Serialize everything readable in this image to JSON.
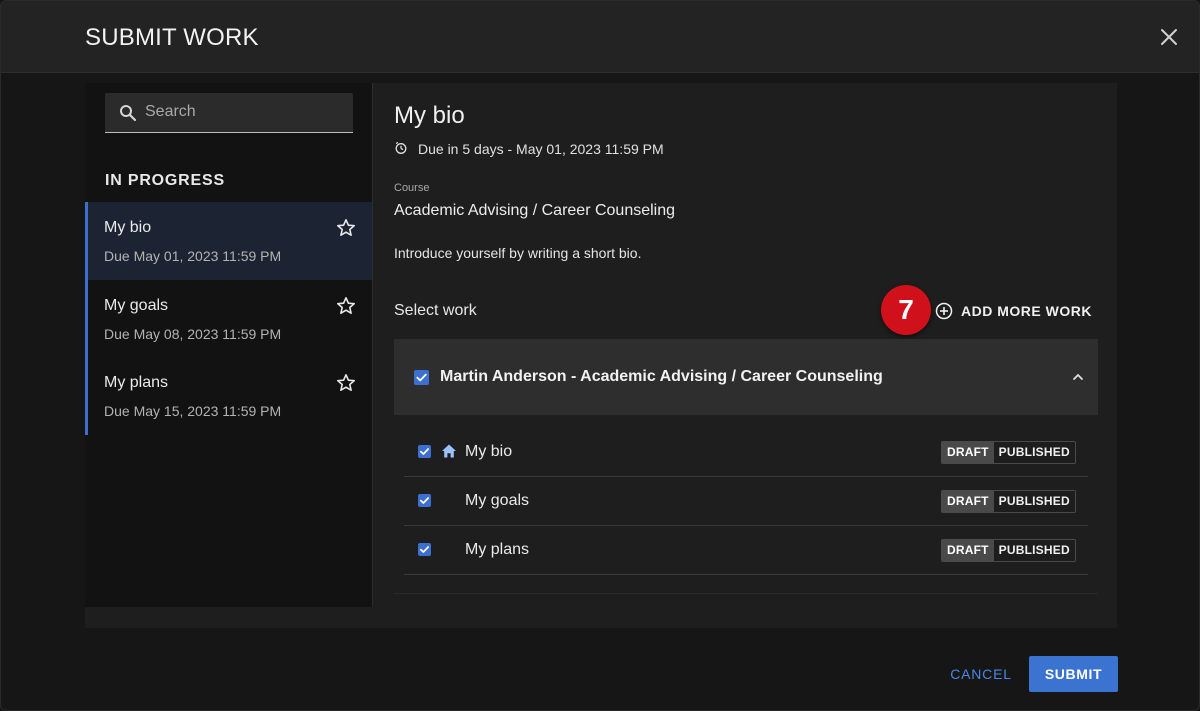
{
  "dialog": {
    "title": "SUBMIT WORK"
  },
  "search": {
    "placeholder": "Search",
    "value": ""
  },
  "sidebar": {
    "section_label": "IN PROGRESS",
    "items": [
      {
        "name": "My bio",
        "due": "Due May 01, 2023 11:59 PM",
        "active": true
      },
      {
        "name": "My goals",
        "due": "Due May 08, 2023 11:59 PM",
        "active": false
      },
      {
        "name": "My plans",
        "due": "Due May 15, 2023 11:59 PM",
        "active": false
      }
    ]
  },
  "main": {
    "title": "My bio",
    "due_text": "Due in 5 days - May 01, 2023 11:59 PM",
    "course_label": "Course",
    "course_name": "Academic Advising / Career Counseling",
    "description": "Introduce yourself by writing a short bio.",
    "select_label": "Select work",
    "step_badge": "7",
    "add_more_label": "ADD MORE WORK",
    "group": {
      "name": "Martin Anderson - Academic Advising / Career Counseling",
      "checked": true,
      "expanded": true
    },
    "work_items": [
      {
        "name": "My bio",
        "checked": true,
        "icon": "home-icon",
        "draft_label": "DRAFT",
        "published_label": "PUBLISHED",
        "status": "DRAFT"
      },
      {
        "name": "My goals",
        "checked": true,
        "icon": "",
        "draft_label": "DRAFT",
        "published_label": "PUBLISHED",
        "status": "DRAFT"
      },
      {
        "name": "My plans",
        "checked": true,
        "icon": "",
        "draft_label": "DRAFT",
        "published_label": "PUBLISHED",
        "status": "DRAFT"
      }
    ]
  },
  "footer": {
    "cancel_label": "CANCEL",
    "submit_label": "SUBMIT"
  },
  "colors": {
    "accent": "#3a74d0",
    "badge": "#d0111b",
    "active_item_bg": "#1c2433"
  }
}
